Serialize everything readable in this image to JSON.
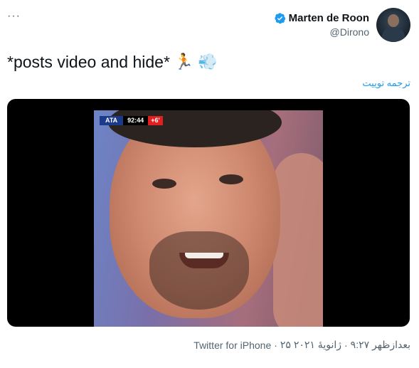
{
  "header": {
    "more_label": "···",
    "display_name": "Marten de Roon",
    "handle": "@Dirono"
  },
  "tweet": {
    "text": "*posts video and hide*",
    "emojis": [
      "🏃",
      "💨"
    ],
    "translate_label": "ترجمه توییت"
  },
  "media": {
    "scorebug": {
      "team": "ATA",
      "clock": "92:44",
      "added": "+6'"
    }
  },
  "meta": {
    "time": "۹:۲۷ بعدازظهر",
    "separator": "·",
    "date": "۲۵ ژانویهٔ ۲۰۲۱",
    "source": "Twitter for iPhone"
  },
  "colors": {
    "accent": "#1d9bf0",
    "secondary_text": "#536471"
  }
}
